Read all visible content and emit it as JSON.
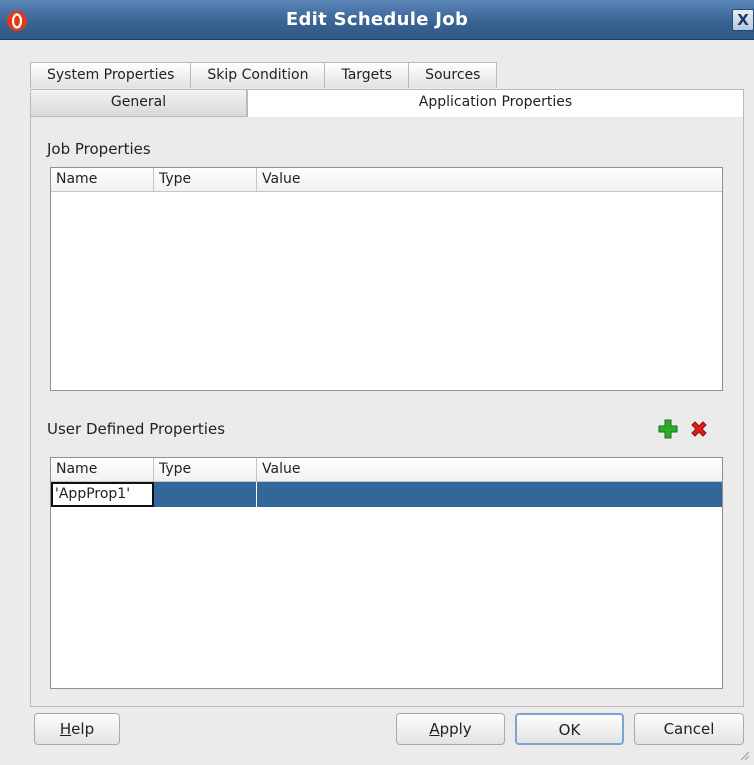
{
  "window": {
    "title": "Edit Schedule Job",
    "close_glyph": "X"
  },
  "tabs_row1": [
    "System Properties",
    "Skip Condition",
    "Targets",
    "Sources"
  ],
  "tabs_row2": {
    "general": "General",
    "application": "Application Properties"
  },
  "job_properties": {
    "label": "Job Properties",
    "columns": [
      "Name",
      "Type",
      "Value"
    ]
  },
  "user_defined": {
    "label": "User Defined Properties",
    "columns": [
      "Name",
      "Type",
      "Value"
    ],
    "rows": [
      {
        "name": "'AppProp1'",
        "type": "",
        "value": ""
      }
    ]
  },
  "buttons": {
    "help_mnemonic": "H",
    "help_rest": "elp",
    "apply_mnemonic": "A",
    "apply_rest": "pply",
    "ok": "OK",
    "cancel": "Cancel"
  },
  "colors": {
    "selection": "#336799",
    "titlebar": "#3a6494",
    "add": "#2faa2f",
    "remove": "#e0201a"
  }
}
